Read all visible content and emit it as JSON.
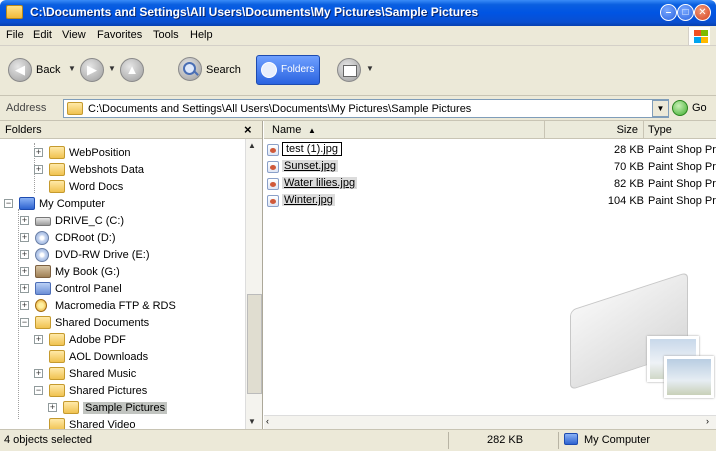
{
  "window": {
    "title": "C:\\Documents and Settings\\All Users\\Documents\\My Pictures\\Sample Pictures"
  },
  "menu": [
    "File",
    "Edit",
    "View",
    "Favorites",
    "Tools",
    "Help"
  ],
  "toolbar": {
    "back": "Back",
    "search": "Search",
    "folders": "Folders"
  },
  "address": {
    "label": "Address",
    "path": "C:\\Documents and Settings\\All Users\\Documents\\My Pictures\\Sample Pictures",
    "go": "Go"
  },
  "folders_pane": {
    "title": "Folders",
    "close": "×",
    "items": [
      {
        "label": "WebPosition",
        "icon": "folder-icon",
        "expander": "+"
      },
      {
        "label": "Webshots Data",
        "icon": "folder-icon",
        "expander": "+"
      },
      {
        "label": "Word Docs",
        "icon": "folder-icon",
        "expander": ""
      },
      {
        "label": "My Computer",
        "icon": "computer-icon",
        "expander": "−"
      },
      {
        "label": "DRIVE_C (C:)",
        "icon": "hard-drive-icon",
        "expander": "+"
      },
      {
        "label": "CDRoot (D:)",
        "icon": "cd-drive-icon",
        "expander": "+"
      },
      {
        "label": "DVD-RW Drive (E:)",
        "icon": "dvd-drive-icon",
        "expander": "+"
      },
      {
        "label": "My Book (G:)",
        "icon": "external-drive-icon",
        "expander": "+"
      },
      {
        "label": "Control Panel",
        "icon": "control-panel-icon",
        "expander": "+"
      },
      {
        "label": "Macromedia FTP & RDS",
        "icon": "ftp-icon",
        "expander": "+"
      },
      {
        "label": "Shared Documents",
        "icon": "folder-icon",
        "expander": "−"
      },
      {
        "label": "Adobe PDF",
        "icon": "folder-icon",
        "expander": "+"
      },
      {
        "label": "AOL Downloads",
        "icon": "folder-icon",
        "expander": ""
      },
      {
        "label": "Shared Music",
        "icon": "folder-icon",
        "expander": "+"
      },
      {
        "label": "Shared Pictures",
        "icon": "folder-icon",
        "expander": "−"
      },
      {
        "label": "Sample Pictures",
        "icon": "folder-icon",
        "expander": "+"
      },
      {
        "label": "Shared Video",
        "icon": "folder-icon",
        "expander": ""
      }
    ]
  },
  "file_list": {
    "columns": {
      "name": "Name",
      "sort_arrow": "▲",
      "size": "Size",
      "type": "Type"
    },
    "files": [
      {
        "name": "test (1).jpg",
        "size": "28 KB",
        "type": "Paint Shop Pro"
      },
      {
        "name": "Sunset.jpg",
        "size": "70 KB",
        "type": "Paint Shop Pro"
      },
      {
        "name": "Water lilies.jpg",
        "size": "82 KB",
        "type": "Paint Shop Pro"
      },
      {
        "name": "Winter.jpg",
        "size": "104 KB",
        "type": "Paint Shop Pro"
      }
    ]
  },
  "status": {
    "selection": "4 objects selected",
    "size": "282 KB",
    "location": "My Computer"
  },
  "colors": {
    "titlebar": "#0054e3",
    "chrome": "#ece9d8",
    "selection": "#c1c4c0"
  }
}
